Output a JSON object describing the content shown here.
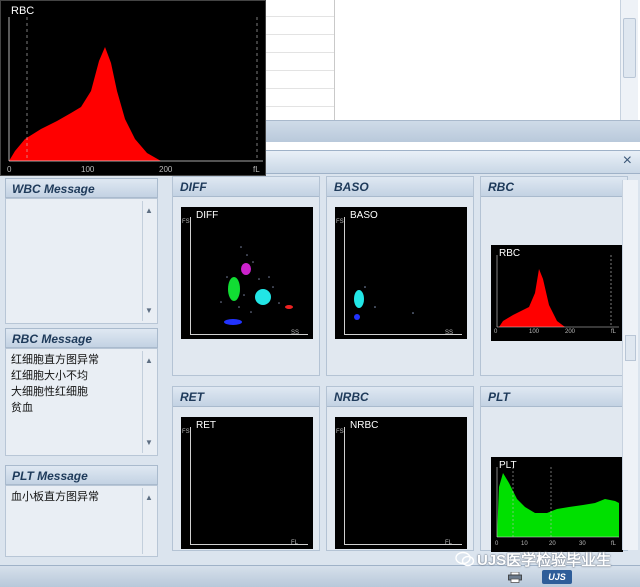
{
  "panel": {
    "close_label": "×"
  },
  "messages": {
    "wbc": {
      "title": "WBC Message",
      "lines": []
    },
    "rbc": {
      "title": "RBC Message",
      "lines": [
        "红细胞直方图异常",
        "红细胞大小不均",
        "大细胞性红细胞",
        "贫血"
      ]
    },
    "plt": {
      "title": "PLT Message",
      "lines": [
        "血小板直方图异常"
      ]
    }
  },
  "plots": {
    "diff": {
      "title": "DIFF",
      "label": "DIFF",
      "x_axis": "SS",
      "y_axis": "FS"
    },
    "baso": {
      "title": "BASO",
      "label": "BASO",
      "x_axis": "SS",
      "y_axis": "FS"
    },
    "rbc": {
      "title": "RBC",
      "label": "RBC",
      "x_axis": "fL",
      "ticks": [
        "0",
        "100",
        "200"
      ]
    },
    "ret": {
      "title": "RET",
      "label": "RET",
      "x_axis": "FL",
      "y_axis": "FS"
    },
    "nrbc": {
      "title": "NRBC",
      "label": "NRBC",
      "x_axis": "FL",
      "y_axis": "FS"
    },
    "plt": {
      "title": "PLT",
      "label": "PLT",
      "x_axis": "fL",
      "ticks": [
        "0",
        "10",
        "20",
        "30"
      ]
    }
  },
  "rbc_zoom": {
    "label": "RBC",
    "x_axis": "fL",
    "ticks": [
      "0",
      "100",
      "200"
    ]
  },
  "watermark": {
    "text": "UJS医学检验毕业生"
  },
  "statusbar": {
    "brand": "UJS"
  },
  "colors": {
    "rbc_fill": "#ff0000",
    "plt_fill": "#00e000",
    "header_text": "#1e3a5a"
  },
  "icons": [
    "printer-icon",
    "close-icon",
    "wechat-icon"
  ]
}
